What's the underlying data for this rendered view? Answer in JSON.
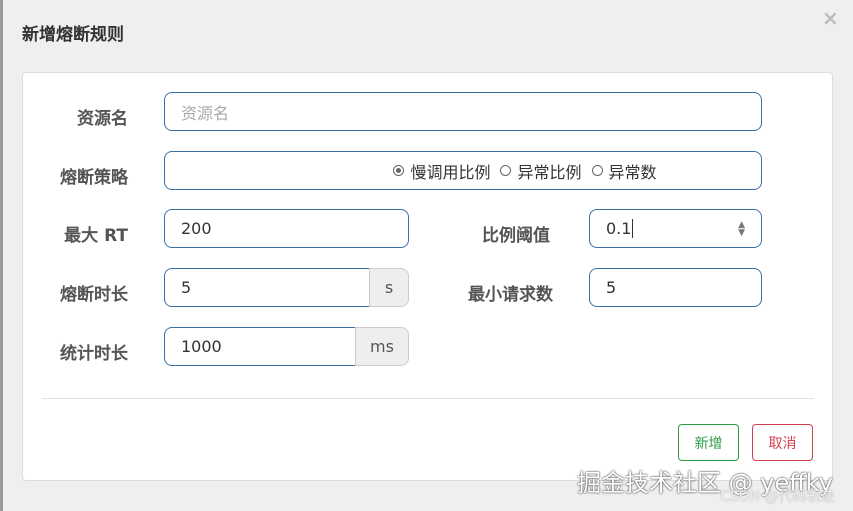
{
  "dialog": {
    "title": "新增熔断规则",
    "close": "×"
  },
  "form": {
    "resource": {
      "label": "资源名",
      "placeholder": "资源名",
      "value": ""
    },
    "strategy": {
      "label": "熔断策略",
      "options": [
        "慢调用比例",
        "异常比例",
        "异常数"
      ],
      "selected": "慢调用比例"
    },
    "max_rt": {
      "label": "最大 RT",
      "value": "200"
    },
    "ratio": {
      "label": "比例阈值",
      "value": "0.1"
    },
    "break_time": {
      "label": "熔断时长",
      "value": "5",
      "unit": "s"
    },
    "min_requests": {
      "label": "最小请求数",
      "value": "5"
    },
    "stat_time": {
      "label": "统计时长",
      "value": "1000",
      "unit": "ms"
    }
  },
  "buttons": {
    "add": "新增",
    "cancel": "取消"
  },
  "watermarks": {
    "juejin": "掘金技术社区 @ yeffky",
    "csdn": "CSDN @代码轨迹"
  },
  "colors": {
    "add": "#2e9e45",
    "cancel": "#d43f4f",
    "input_border": "#3a6fa5"
  }
}
